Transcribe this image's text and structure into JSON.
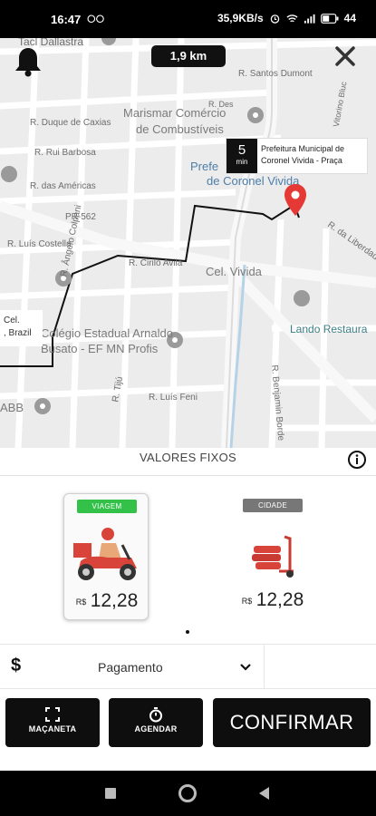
{
  "status_bar": {
    "time": "16:47",
    "left_icon": "voicemail-icon",
    "network_speed": "35,9KB/s",
    "battery": "44"
  },
  "map": {
    "distance": "1,9 km",
    "eta": {
      "value": "5",
      "unit": "min"
    },
    "destination": {
      "line1": "Prefeitura Municipal de",
      "line2": "Coronel Vivida - Praça"
    },
    "origin": {
      "line1": "Cel.",
      "line2": ", Brazil"
    },
    "labels": {
      "tacl": "Tacl Dallastra",
      "santos_dumont": "R. Santos Dumont",
      "marismar": "Marismar Comércio",
      "combustiveis": "de Combustíveis",
      "duque": "R. Duque de Caxias",
      "rui": "R. Rui Barbosa",
      "americas": "R. das Américas",
      "prefe": "Prefe",
      "coronel": "de Coronel Vivida",
      "pr562": "PR-562",
      "liberdade": "R. da Liberdade",
      "luis_costella": "R. Luís Costella",
      "cirilo": "R. Cirilo Avila",
      "angelo": "R. Ângelo Colpani",
      "cel_vivida": "Cel. Vivida",
      "colegio": "Colégio Estadual Arnaldo",
      "busato": "Busato - EF MN Profis",
      "lando": "Lando Restaura",
      "tiju": "R. Tijú",
      "luis_feni": "R. Luís Feni",
      "benjamin": "R. Benjamin Borde",
      "abb": "ABB",
      "des": "R. Des",
      "vitorino": "Vitorino Bluc"
    }
  },
  "sheet": {
    "title": "VALORES FIXOS",
    "options": [
      {
        "badge": "VIAGEM",
        "currency": "R$",
        "price": "12,28",
        "selected": true
      },
      {
        "badge": "CIDADE",
        "currency": "R$",
        "price": "12,28",
        "selected": false
      }
    ],
    "payment": {
      "symbol": "$",
      "label": "Pagamento"
    },
    "buttons": {
      "macaneta": "MAÇANETA",
      "agendar": "AGENDAR",
      "confirmar": "CONFIRMAR"
    }
  },
  "colors": {
    "badge_selected": "#33c14a",
    "badge_unselected": "#777777",
    "pin": "#e53935"
  }
}
